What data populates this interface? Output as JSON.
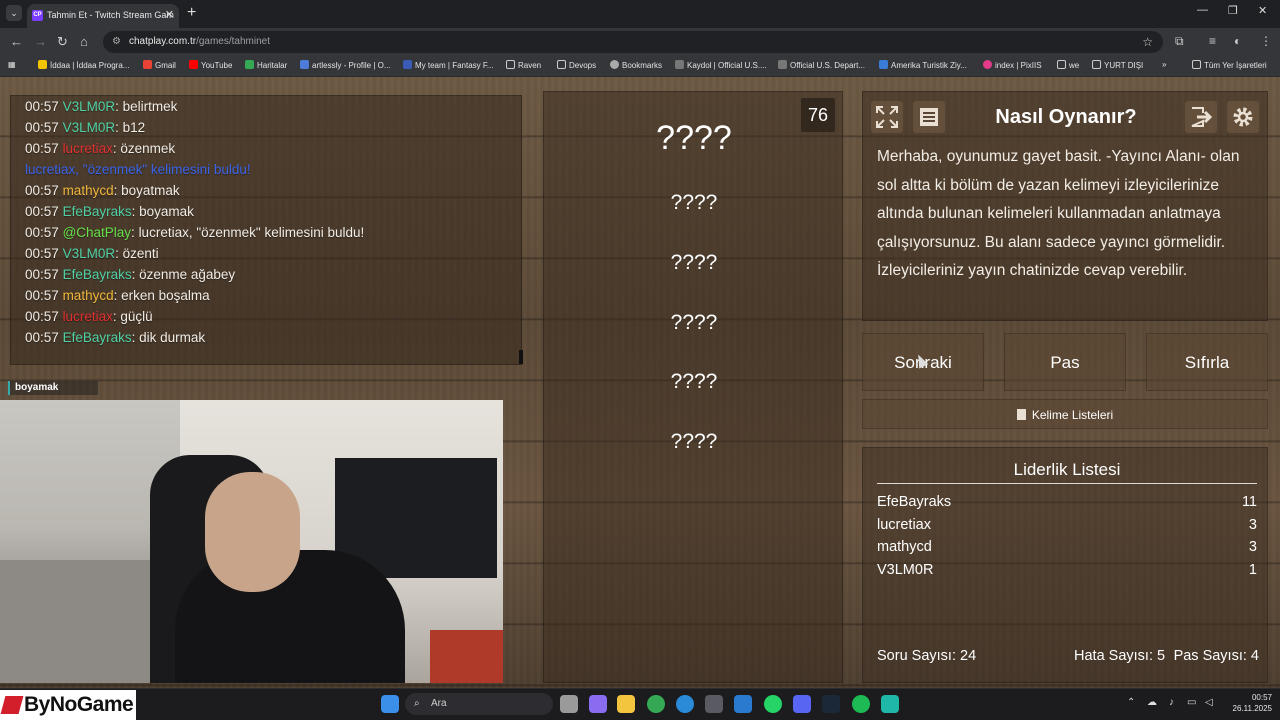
{
  "browser": {
    "tab_title": "Tahmin Et - Twitch Stream Gam",
    "tab_favicon": "CP",
    "url_host": "chatplay.com.tr",
    "url_path": "/games/tahminet",
    "bookmarks": [
      "İddaa | İddaa Progra...",
      "Gmail",
      "YouTube",
      "Haritalar",
      "artlessly - Profile | O...",
      "My team | Fantasy F...",
      "Raven",
      "Devops",
      "Bookmarks",
      "Kaydol | Official U.S....",
      "Official U.S. Depart...",
      "Amerika Turistik Ziy...",
      "index | PixIIS",
      "we",
      "YURT DIŞI",
      "»",
      "Tüm Yer İşaretleri"
    ]
  },
  "chat": {
    "messages": [
      {
        "time": "00:57",
        "user": "V3LM0R",
        "color": "#4fd1a5",
        "text": "belirtmek"
      },
      {
        "time": "00:57",
        "user": "V3LM0R",
        "color": "#4fd1a5",
        "text": "b12"
      },
      {
        "time": "00:57",
        "user": "lucretiax",
        "color": "#e03030",
        "text": "özenmek"
      },
      {
        "time": "",
        "user": "lucretiax, \"özenmek\" kelimesini buldu!",
        "color": "#3a63e8",
        "text": ""
      },
      {
        "time": "00:57",
        "user": "mathycd",
        "color": "#f0b73c",
        "text": "boyatmak"
      },
      {
        "time": "00:57",
        "user": "EfeBayraks",
        "color": "#4fd1a5",
        "text": "boyamak"
      },
      {
        "time": "00:57",
        "user": "@ChatPlay",
        "color": "#66e04a",
        "text": "lucretiax, \"özenmek\" kelimesini buldu!"
      },
      {
        "time": "00:57",
        "user": "V3LM0R",
        "color": "#4fd1a5",
        "text": "özenti"
      },
      {
        "time": "00:57",
        "user": "EfeBayraks",
        "color": "#4fd1a5",
        "text": "özenme ağabey"
      },
      {
        "time": "00:57",
        "user": "mathycd",
        "color": "#f0b73c",
        "text": "erken boşalma"
      },
      {
        "time": "00:57",
        "user": "lucretiax",
        "color": "#e03030",
        "text": "güçlü"
      },
      {
        "time": "00:57",
        "user": "EfeBayraks",
        "color": "#4fd1a5",
        "text": "dik durmak"
      }
    ]
  },
  "webcam": {
    "label": "boyamak"
  },
  "game": {
    "timer": "76",
    "hidden_words": [
      "????",
      "????",
      "????",
      "????",
      "????",
      "????"
    ]
  },
  "how_to": {
    "title": "Nasıl Oynanır?",
    "text": "Merhaba, oyunumuz gayet basit. -Yayıncı Alanı- olan sol altta ki bölüm de yazan kelimeyi izleyicilerinize altında bulunan kelimeleri kullanmadan anlatmaya çalışıyorsunuz. Bu alanı sadece yayıncı görmelidir. İzleyicileriniz yayın chatinizde cevap verebilir."
  },
  "buttons": {
    "next": "Sonraki",
    "pass": "Pas",
    "reset": "Sıfırla",
    "word_lists": "Kelime Listeleri"
  },
  "leaderboard": {
    "title": "Liderlik Listesi",
    "rows": [
      {
        "name": "EfeBayraks",
        "score": "11"
      },
      {
        "name": "lucretiax",
        "score": "3"
      },
      {
        "name": "mathycd",
        "score": "3"
      },
      {
        "name": "V3LM0R",
        "score": "1"
      }
    ],
    "questions_label": "Soru Sayısı: 24",
    "errors_label": "Hata Sayısı: 5",
    "passes_label": "Pas Sayısı: 4"
  },
  "taskbar": {
    "logo": "ByNoGame",
    "search_placeholder": "Ara",
    "time": "00:57",
    "date": "26.11.2025"
  },
  "colors": {
    "wood": "#5c4a37",
    "panel": "#34281d"
  }
}
